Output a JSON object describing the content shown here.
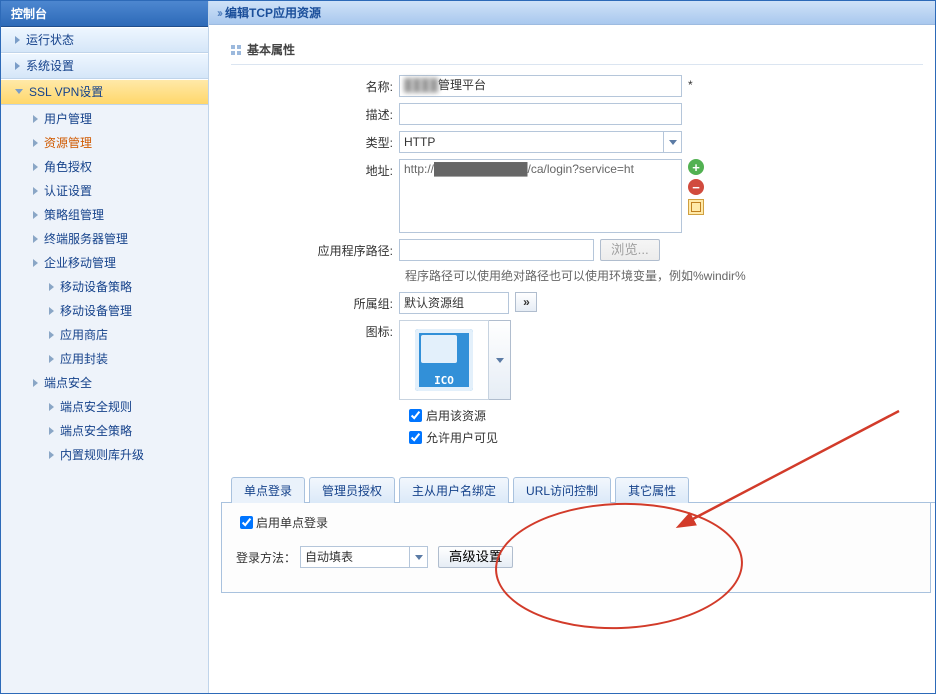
{
  "sidebar": {
    "title": "控制台",
    "groups": [
      {
        "label": "运行状态"
      },
      {
        "label": "系统设置"
      },
      {
        "label": "SSL VPN设置",
        "items": [
          {
            "label": "用户管理"
          },
          {
            "label": "资源管理",
            "active": true
          },
          {
            "label": "角色授权"
          },
          {
            "label": "认证设置"
          },
          {
            "label": "策略组管理"
          },
          {
            "label": "终端服务器管理"
          },
          {
            "label": "企业移动管理",
            "expandable": true,
            "children": [
              {
                "label": "移动设备策略"
              },
              {
                "label": "移动设备管理"
              },
              {
                "label": "应用商店"
              },
              {
                "label": "应用封装"
              }
            ]
          },
          {
            "label": "端点安全",
            "expandable": true,
            "children": [
              {
                "label": "端点安全规则"
              },
              {
                "label": "端点安全策略"
              },
              {
                "label": "内置规则库升级"
              }
            ]
          }
        ]
      }
    ]
  },
  "page": {
    "title": "编辑TCP应用资源",
    "section_title": "基本属性",
    "labels": {
      "name": "名称",
      "desc": "描述",
      "type": "类型",
      "addr": "地址",
      "app_path": "应用程序路径",
      "group": "所属组",
      "icon": "图标"
    },
    "values": {
      "name_blur": "████",
      "name_suffix": "管理平台",
      "type": "HTTP",
      "addr": "http://███████████/ca/login?service=ht",
      "group": "默认资源组",
      "req_mark": "*",
      "group_dbl": "»"
    },
    "buttons": {
      "browse": "浏览...",
      "adv": "高级设置"
    },
    "hint": "程序路径可以使用绝对路径也可以使用环境变量，例如%windir%",
    "ico_label": "ICO",
    "checks": {
      "enable": "启用该资源",
      "visible": "允许用户可见"
    },
    "tabs": [
      {
        "label": "单点登录",
        "active": true
      },
      {
        "label": "管理员授权"
      },
      {
        "label": "主从用户名绑定"
      },
      {
        "label": "URL访问控制"
      },
      {
        "label": "其它属性"
      }
    ],
    "sso": {
      "enable": "启用单点登录",
      "method_label": "登录方法：",
      "method_value": "自动填表"
    }
  }
}
